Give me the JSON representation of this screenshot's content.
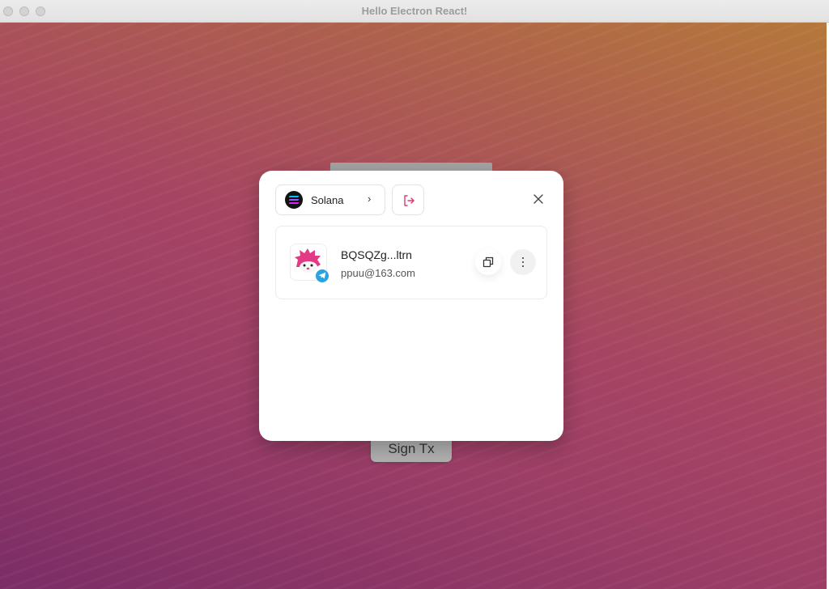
{
  "window": {
    "title": "Hello Electron React!"
  },
  "background": {
    "sign_button_label": "Sign Tx"
  },
  "modal": {
    "chain_selector": {
      "name": "Solana",
      "chevron": "›",
      "icon": "solana-logo"
    },
    "logout_icon": "logout-icon",
    "close_icon": "close-icon",
    "account": {
      "address": "BQSQZg...ltrn",
      "email": "ppuu@163.com",
      "avatar_icon": "hedgehog-avatar",
      "badge_icon": "telegram-icon"
    },
    "copy_icon": "copy-icon",
    "more_icon": "more-vertical-icon"
  },
  "colors": {
    "accent_pink": "#e0386f",
    "telegram_blue": "#2aa3e2",
    "wallpaper_top": "#b5783a",
    "wallpaper_bottom": "#7b2d66"
  }
}
